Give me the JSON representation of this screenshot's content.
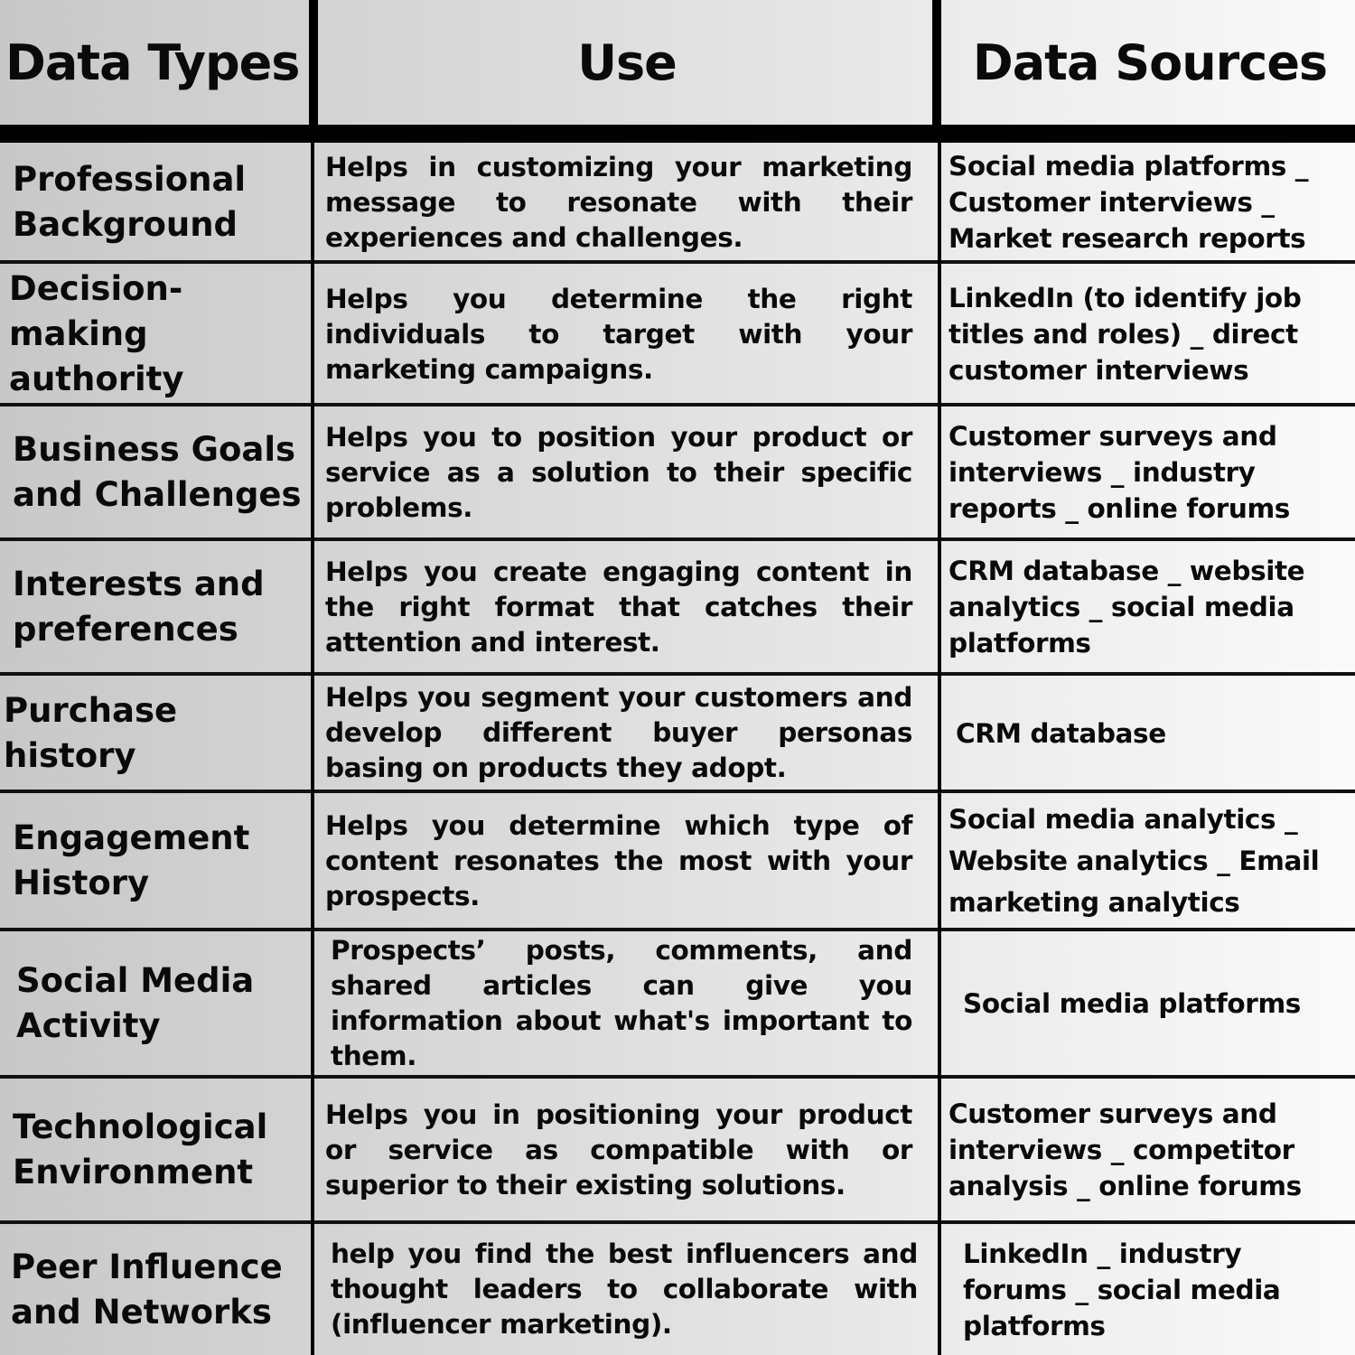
{
  "header": {
    "col_types": "Data Types",
    "col_use": "Use",
    "col_sources": "Data Sources"
  },
  "rows": [
    {
      "type": "Professional Background",
      "use": "Helps in customizing your marketing message to resonate with their experiences and challenges.",
      "sources": "Social media platforms _ Customer interviews _ Market research reports"
    },
    {
      "type": "Decision-making authority",
      "use": "Helps you determine the right individuals to target with your marketing campaigns.",
      "sources": "LinkedIn (to identify job titles and roles) _ direct customer interviews"
    },
    {
      "type": "Business Goals and Challenges",
      "use": "Helps you to position your product or service as a solution to their specific problems.",
      "sources": "Customer surveys and interviews _ industry reports _ online forums"
    },
    {
      "type": "Interests and preferences",
      "use": "Helps you create engaging content in the right format that catches their attention and interest.",
      "sources": "CRM database _ website analytics _ social media platforms"
    },
    {
      "type": "Purchase history",
      "use": "Helps you segment your customers and develop different buyer personas basing on products they adopt.",
      "sources": "CRM database"
    },
    {
      "type": "Engagement History",
      "use": "Helps you determine which type of content resonates the most with your prospects.",
      "sources": "Social media analytics _ Website analytics _ Email marketing analytics"
    },
    {
      "type": "Social Media Activity",
      "use": "Prospects’ posts, comments, and shared articles can give you information about what's important to them.",
      "sources": "Social media platforms"
    },
    {
      "type": "Technological Environment",
      "use": "Helps you in positioning your product or service as compatible with or superior to their existing solutions.",
      "sources": "Customer surveys and interviews _ competitor analysis _ online forums"
    },
    {
      "type": "Peer Influence and Networks",
      "use": "help you find the best influencers and thought leaders to collaborate with (influencer marketing).",
      "sources": "LinkedIn _ industry forums _ social media platforms"
    }
  ]
}
